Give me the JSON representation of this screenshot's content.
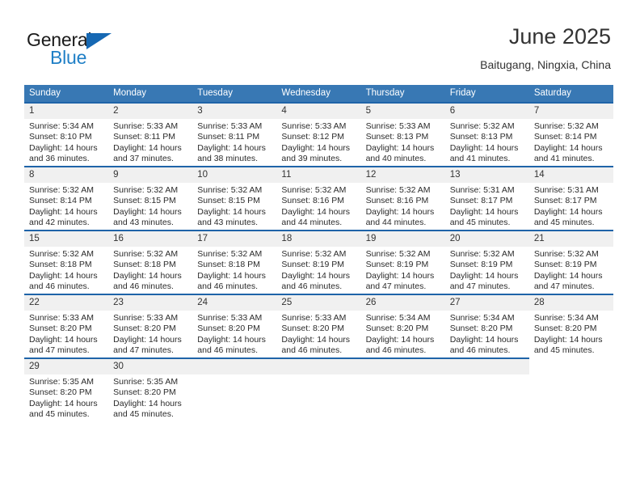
{
  "brand": {
    "word1": "General",
    "word2": "Blue",
    "triangle_color": "#1668b3",
    "blue_color": "#1f7fc6"
  },
  "header": {
    "month_title": "June 2025",
    "location": "Baitugang, Ningxia, China"
  },
  "theme": {
    "header_bg": "#3878b4",
    "row_accent": "#1f64a8",
    "daynum_bg": "#f0f0f0"
  },
  "calendar": {
    "weekday_headers": [
      "Sunday",
      "Monday",
      "Tuesday",
      "Wednesday",
      "Thursday",
      "Friday",
      "Saturday"
    ],
    "weeks": [
      [
        {
          "day": "1",
          "sunrise": "Sunrise: 5:34 AM",
          "sunset": "Sunset: 8:10 PM",
          "daylight": "Daylight: 14 hours and 36 minutes."
        },
        {
          "day": "2",
          "sunrise": "Sunrise: 5:33 AM",
          "sunset": "Sunset: 8:11 PM",
          "daylight": "Daylight: 14 hours and 37 minutes."
        },
        {
          "day": "3",
          "sunrise": "Sunrise: 5:33 AM",
          "sunset": "Sunset: 8:11 PM",
          "daylight": "Daylight: 14 hours and 38 minutes."
        },
        {
          "day": "4",
          "sunrise": "Sunrise: 5:33 AM",
          "sunset": "Sunset: 8:12 PM",
          "daylight": "Daylight: 14 hours and 39 minutes."
        },
        {
          "day": "5",
          "sunrise": "Sunrise: 5:33 AM",
          "sunset": "Sunset: 8:13 PM",
          "daylight": "Daylight: 14 hours and 40 minutes."
        },
        {
          "day": "6",
          "sunrise": "Sunrise: 5:32 AM",
          "sunset": "Sunset: 8:13 PM",
          "daylight": "Daylight: 14 hours and 41 minutes."
        },
        {
          "day": "7",
          "sunrise": "Sunrise: 5:32 AM",
          "sunset": "Sunset: 8:14 PM",
          "daylight": "Daylight: 14 hours and 41 minutes."
        }
      ],
      [
        {
          "day": "8",
          "sunrise": "Sunrise: 5:32 AM",
          "sunset": "Sunset: 8:14 PM",
          "daylight": "Daylight: 14 hours and 42 minutes."
        },
        {
          "day": "9",
          "sunrise": "Sunrise: 5:32 AM",
          "sunset": "Sunset: 8:15 PM",
          "daylight": "Daylight: 14 hours and 43 minutes."
        },
        {
          "day": "10",
          "sunrise": "Sunrise: 5:32 AM",
          "sunset": "Sunset: 8:15 PM",
          "daylight": "Daylight: 14 hours and 43 minutes."
        },
        {
          "day": "11",
          "sunrise": "Sunrise: 5:32 AM",
          "sunset": "Sunset: 8:16 PM",
          "daylight": "Daylight: 14 hours and 44 minutes."
        },
        {
          "day": "12",
          "sunrise": "Sunrise: 5:32 AM",
          "sunset": "Sunset: 8:16 PM",
          "daylight": "Daylight: 14 hours and 44 minutes."
        },
        {
          "day": "13",
          "sunrise": "Sunrise: 5:31 AM",
          "sunset": "Sunset: 8:17 PM",
          "daylight": "Daylight: 14 hours and 45 minutes."
        },
        {
          "day": "14",
          "sunrise": "Sunrise: 5:31 AM",
          "sunset": "Sunset: 8:17 PM",
          "daylight": "Daylight: 14 hours and 45 minutes."
        }
      ],
      [
        {
          "day": "15",
          "sunrise": "Sunrise: 5:32 AM",
          "sunset": "Sunset: 8:18 PM",
          "daylight": "Daylight: 14 hours and 46 minutes."
        },
        {
          "day": "16",
          "sunrise": "Sunrise: 5:32 AM",
          "sunset": "Sunset: 8:18 PM",
          "daylight": "Daylight: 14 hours and 46 minutes."
        },
        {
          "day": "17",
          "sunrise": "Sunrise: 5:32 AM",
          "sunset": "Sunset: 8:18 PM",
          "daylight": "Daylight: 14 hours and 46 minutes."
        },
        {
          "day": "18",
          "sunrise": "Sunrise: 5:32 AM",
          "sunset": "Sunset: 8:19 PM",
          "daylight": "Daylight: 14 hours and 46 minutes."
        },
        {
          "day": "19",
          "sunrise": "Sunrise: 5:32 AM",
          "sunset": "Sunset: 8:19 PM",
          "daylight": "Daylight: 14 hours and 47 minutes."
        },
        {
          "day": "20",
          "sunrise": "Sunrise: 5:32 AM",
          "sunset": "Sunset: 8:19 PM",
          "daylight": "Daylight: 14 hours and 47 minutes."
        },
        {
          "day": "21",
          "sunrise": "Sunrise: 5:32 AM",
          "sunset": "Sunset: 8:19 PM",
          "daylight": "Daylight: 14 hours and 47 minutes."
        }
      ],
      [
        {
          "day": "22",
          "sunrise": "Sunrise: 5:33 AM",
          "sunset": "Sunset: 8:20 PM",
          "daylight": "Daylight: 14 hours and 47 minutes."
        },
        {
          "day": "23",
          "sunrise": "Sunrise: 5:33 AM",
          "sunset": "Sunset: 8:20 PM",
          "daylight": "Daylight: 14 hours and 47 minutes."
        },
        {
          "day": "24",
          "sunrise": "Sunrise: 5:33 AM",
          "sunset": "Sunset: 8:20 PM",
          "daylight": "Daylight: 14 hours and 46 minutes."
        },
        {
          "day": "25",
          "sunrise": "Sunrise: 5:33 AM",
          "sunset": "Sunset: 8:20 PM",
          "daylight": "Daylight: 14 hours and 46 minutes."
        },
        {
          "day": "26",
          "sunrise": "Sunrise: 5:34 AM",
          "sunset": "Sunset: 8:20 PM",
          "daylight": "Daylight: 14 hours and 46 minutes."
        },
        {
          "day": "27",
          "sunrise": "Sunrise: 5:34 AM",
          "sunset": "Sunset: 8:20 PM",
          "daylight": "Daylight: 14 hours and 46 minutes."
        },
        {
          "day": "28",
          "sunrise": "Sunrise: 5:34 AM",
          "sunset": "Sunset: 8:20 PM",
          "daylight": "Daylight: 14 hours and 45 minutes."
        }
      ],
      [
        {
          "day": "29",
          "sunrise": "Sunrise: 5:35 AM",
          "sunset": "Sunset: 8:20 PM",
          "daylight": "Daylight: 14 hours and 45 minutes."
        },
        {
          "day": "30",
          "sunrise": "Sunrise: 5:35 AM",
          "sunset": "Sunset: 8:20 PM",
          "daylight": "Daylight: 14 hours and 45 minutes."
        },
        {
          "day": "",
          "sunrise": "",
          "sunset": "",
          "daylight": ""
        },
        {
          "day": "",
          "sunrise": "",
          "sunset": "",
          "daylight": ""
        },
        {
          "day": "",
          "sunrise": "",
          "sunset": "",
          "daylight": ""
        },
        {
          "day": "",
          "sunrise": "",
          "sunset": "",
          "daylight": ""
        },
        {
          "day": "",
          "sunrise": "",
          "sunset": "",
          "daylight": "",
          "blank": true
        }
      ]
    ]
  }
}
